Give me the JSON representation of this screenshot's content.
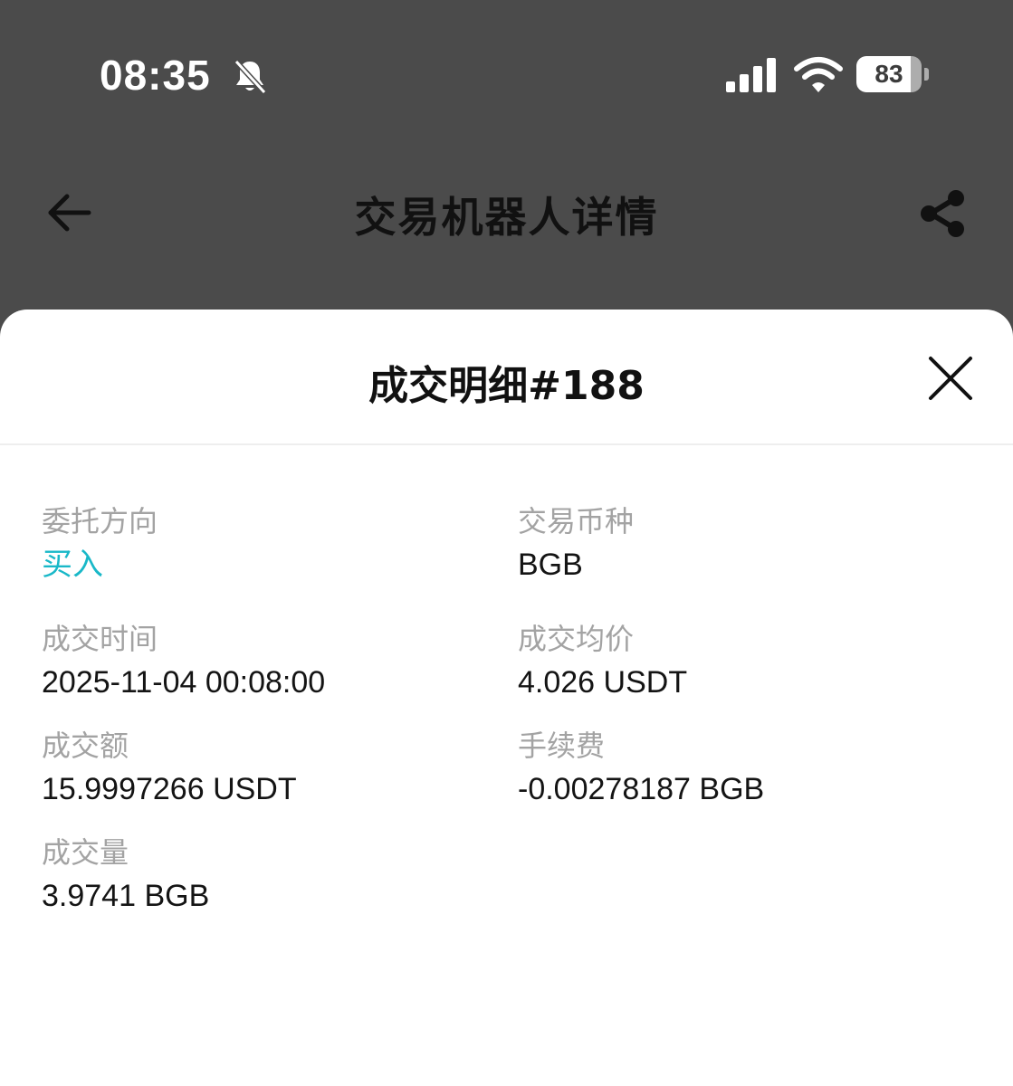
{
  "status_bar": {
    "time": "08:35",
    "icons": [
      "bell-muted-icon",
      "signal-icon",
      "wifi-icon",
      "battery-icon"
    ],
    "battery_level": "83",
    "battery_fraction": 0.83
  },
  "nav": {
    "title": "交易机器人详情",
    "back_icon": "arrow-left-icon",
    "share_icon": "share-icon"
  },
  "sheet": {
    "title": "成交明细#188",
    "close_icon": "close-icon",
    "fields": {
      "direction": {
        "label": "委托方向",
        "value": "买入"
      },
      "symbol": {
        "label": "交易币种",
        "value": "BGB"
      },
      "time": {
        "label": "成交时间",
        "value": "2025-11-04 00:08:00"
      },
      "avg_price": {
        "label": "成交均价",
        "value": "4.026 USDT"
      },
      "amount": {
        "label": "成交额",
        "value": "15.9997266 USDT"
      },
      "fee": {
        "label": "手续费",
        "value": "-0.00278187 BGB"
      },
      "quantity": {
        "label": "成交量",
        "value": "3.9741 BGB"
      }
    }
  },
  "colors": {
    "header_bg": "#4b4b4b",
    "sheet_bg": "#ffffff",
    "buy_color": "#19b8c8",
    "label_color": "#a3a3a3",
    "value_color": "#141414"
  }
}
